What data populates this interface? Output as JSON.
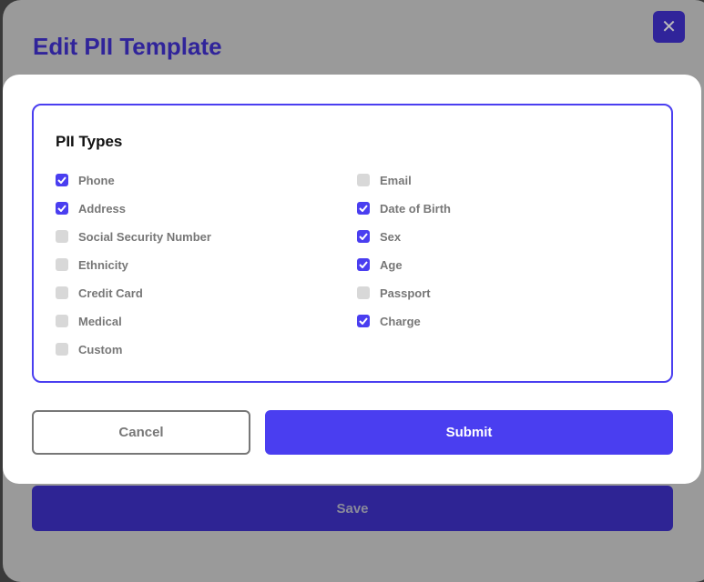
{
  "page": {
    "title": "Edit PII Template",
    "save_label": "Save",
    "close_icon": "close-icon"
  },
  "modal": {
    "section_title": "PII Types",
    "left": [
      {
        "label": "Phone",
        "checked": true
      },
      {
        "label": "Address",
        "checked": true
      },
      {
        "label": "Social Security Number",
        "checked": false
      },
      {
        "label": "Ethnicity",
        "checked": false
      },
      {
        "label": "Credit Card",
        "checked": false
      },
      {
        "label": "Medical",
        "checked": false
      },
      {
        "label": "Custom",
        "checked": false
      }
    ],
    "right": [
      {
        "label": "Email",
        "checked": false
      },
      {
        "label": "Date of Birth",
        "checked": true
      },
      {
        "label": "Sex",
        "checked": true
      },
      {
        "label": "Age",
        "checked": true
      },
      {
        "label": "Passport",
        "checked": false
      },
      {
        "label": "Charge",
        "checked": true
      }
    ],
    "cancel_label": "Cancel",
    "submit_label": "Submit"
  },
  "colors": {
    "accent": "#4a3ef0",
    "dark_accent": "#30249a"
  }
}
